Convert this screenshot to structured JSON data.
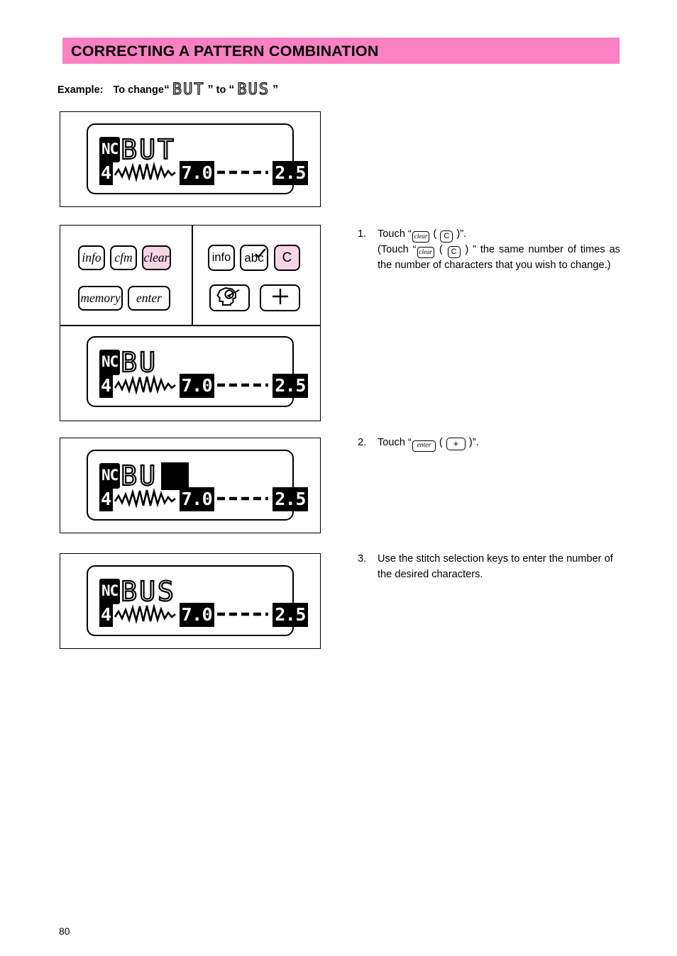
{
  "header": {
    "title": "CORRECTING A PATTERN COMBINATION",
    "band_color": "#fb81c4"
  },
  "example": {
    "label": "Example:",
    "text_before": "To change",
    "open_quote": "“",
    "close_quote": "”",
    "from_word": "BUT",
    "connector": "to",
    "to_word": "BUS"
  },
  "screens": [
    {
      "name": "screen-but",
      "mode_badge": "NC",
      "characters": "BUT",
      "cursor": false,
      "stitch_number": "4",
      "stitch_width": "7.0",
      "stitch_length": "2.5"
    },
    {
      "name": "screen-bu",
      "mode_badge": "NC",
      "characters": "BU",
      "cursor": false,
      "stitch_number": "4",
      "stitch_width": "7.0",
      "stitch_length": "2.5"
    },
    {
      "name": "screen-bu-cursor",
      "mode_badge": "NC",
      "characters": "BU",
      "cursor": true,
      "stitch_number": "4",
      "stitch_width": "7.0",
      "stitch_length": "2.5"
    },
    {
      "name": "screen-bus",
      "mode_badge": "NC",
      "characters": "BUS",
      "cursor": false,
      "stitch_number": "4",
      "stitch_width": "7.0",
      "stitch_length": "2.5"
    }
  ],
  "keypad": {
    "left_group": {
      "keys": [
        {
          "label": "info",
          "icon": "info-key",
          "highlight": false
        },
        {
          "label": "cfm",
          "icon": "cfm-key",
          "highlight": false
        },
        {
          "label": "clear",
          "icon": "clear-key",
          "highlight": true
        },
        {
          "label": "memory",
          "icon": "memory-key",
          "highlight": false
        },
        {
          "label": "enter",
          "icon": "enter-key",
          "highlight": false
        }
      ]
    },
    "right_group": {
      "keys": [
        {
          "label": "info",
          "icon": "info-key",
          "highlight": false
        },
        {
          "label": "abc",
          "icon": "abc-check-key",
          "highlight": false
        },
        {
          "label": "C",
          "icon": "clear-c-key",
          "highlight": true
        },
        {
          "label": "",
          "icon": "head-needle-key",
          "highlight": false
        },
        {
          "label": "+",
          "icon": "plus-key",
          "highlight": false
        }
      ]
    },
    "highlight_color": "#f7d3e6"
  },
  "instructions": [
    {
      "number": "1.",
      "line1_before": "Touch “",
      "line1_key": "clear",
      "line1_paren_open": "(",
      "line1_key2": "C",
      "line1_paren_close": ")",
      "line1_after": "”.",
      "line2_before": "(Touch “",
      "line2_key": "clear",
      "line2_key2": "C",
      "line2_after": "” the same number of times as the number of characters that you wish to change.)"
    },
    {
      "number": "2.",
      "line1_before": "Touch “",
      "line1_key": "enter",
      "line1_paren_open": "(",
      "line1_key2": "+",
      "line1_paren_close": ")",
      "line1_after": "”."
    },
    {
      "number": "3.",
      "text": "Use the stitch selection keys to enter the number of the desired characters."
    }
  ],
  "footer": {
    "page_number": "80"
  }
}
